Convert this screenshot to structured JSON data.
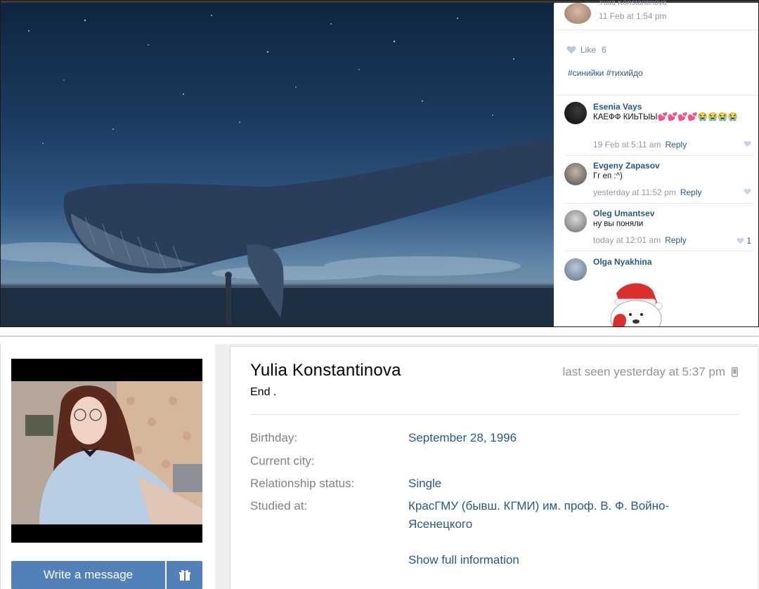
{
  "post": {
    "author": "Yulia Konstantinova",
    "date": "11 Feb at 1:54 pm",
    "like_label": "Like",
    "like_count": "6",
    "hashtags": "#синийки #тихийдо"
  },
  "comments": [
    {
      "name": "Esenia Vays",
      "text": "КАЕФФ КИЬТЫЫ💕💕💕💕😭😭😭😭",
      "date": "19 Feb at 5:11 am",
      "reply": "Reply",
      "likes": ""
    },
    {
      "name": "Evgeny Zapasov",
      "text": "Гг еп :^)",
      "date": "yesterday at 11:52 pm",
      "reply": "Reply",
      "likes": ""
    },
    {
      "name": "Oleg Umantsev",
      "text": "ну вы поняли",
      "date": "today at 12:01 am",
      "reply": "Reply",
      "likes": "1"
    },
    {
      "name": "Olga Nyakhina",
      "text": "",
      "date": "",
      "reply": "",
      "likes": ""
    }
  ],
  "profile": {
    "name": "Yulia Konstantinova",
    "status": "End .",
    "last_seen": "last seen yesterday at 5:37 pm",
    "fields": [
      {
        "label": "Birthday:",
        "value": "September 28, 1996"
      },
      {
        "label": "Current city:",
        "value": ""
      },
      {
        "label": "Relationship status:",
        "value": "Single"
      },
      {
        "label": "Studied at:",
        "value": "КрасГМУ (бывш. КГМИ) им. проф. В. Ф. Войно-Ясенецкого"
      }
    ],
    "show_full": "Show full information",
    "write_message": "Write a message"
  },
  "icons": {
    "like": "heart-icon",
    "gift": "gift-icon",
    "mobile": "mobile-icon"
  },
  "colors": {
    "link": "#2a5885",
    "button": "#5181b8",
    "muted": "#828282"
  }
}
